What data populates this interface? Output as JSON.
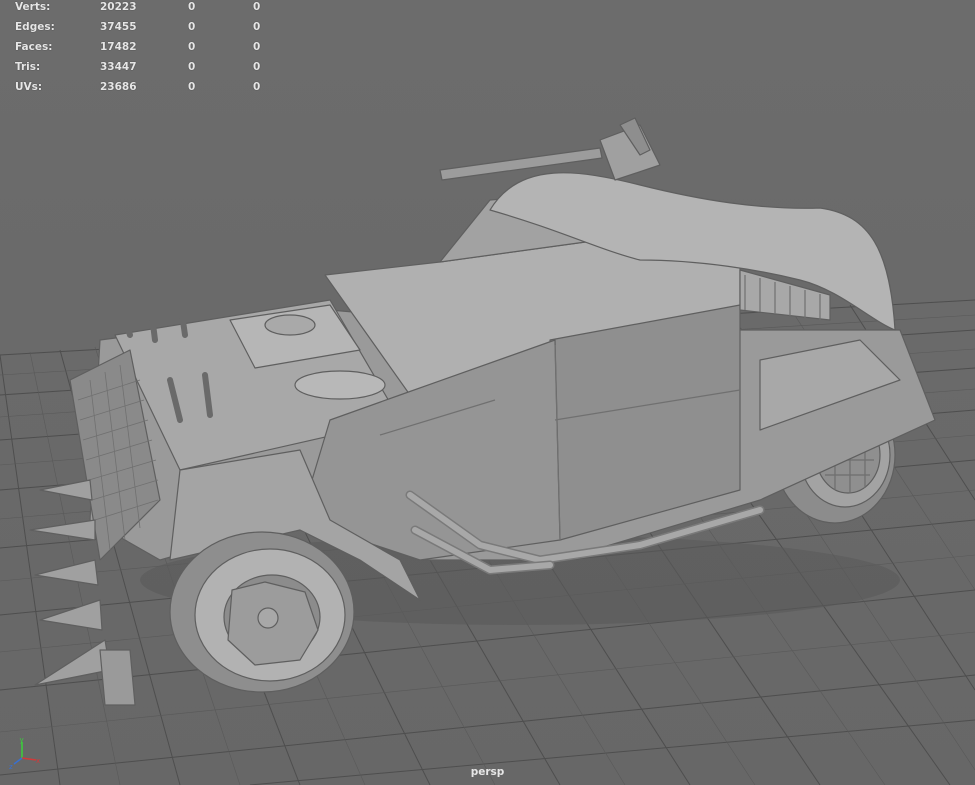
{
  "heads_up": {
    "rows": [
      {
        "label": "Verts:",
        "col1": "20223",
        "col2": "0",
        "col3": "0"
      },
      {
        "label": "Edges:",
        "col1": "37455",
        "col2": "0",
        "col3": "0"
      },
      {
        "label": "Faces:",
        "col1": "17482",
        "col2": "0",
        "col3": "0"
      },
      {
        "label": "Tris:",
        "col1": "33447",
        "col2": "0",
        "col3": "0"
      },
      {
        "label": "UVs:",
        "col1": "23686",
        "col2": "0",
        "col3": "0"
      }
    ]
  },
  "viewport": {
    "camera": "persp",
    "background_color": "#6b6b6b",
    "grid_color": "#4a4a4a",
    "model_color": "#9a9a9a"
  },
  "axis_gizmo": {
    "x_color": "#d03a3a",
    "y_color": "#3ad03a",
    "z_color": "#3a70d0"
  }
}
